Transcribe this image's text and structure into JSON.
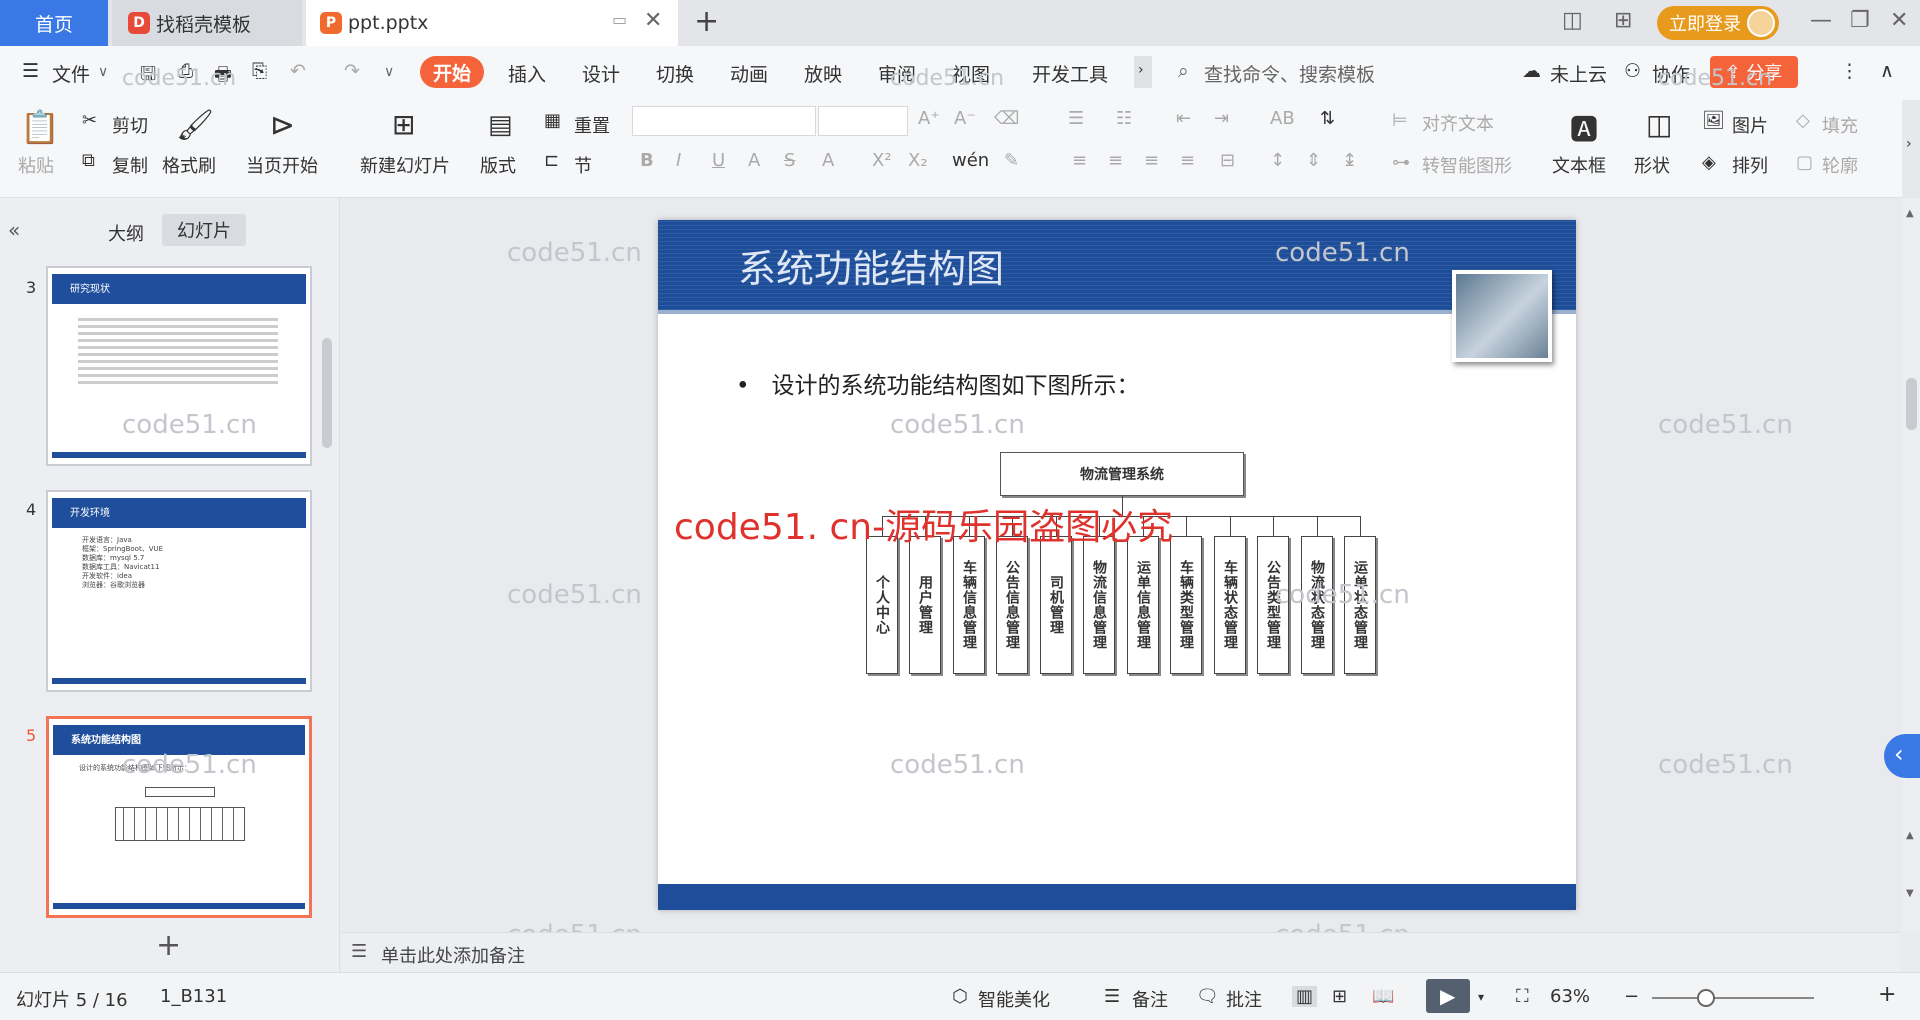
{
  "tabs": {
    "home": "首页",
    "template": "找稻壳模板",
    "doc": "ppt.pptx"
  },
  "header": {
    "login": "立即登录"
  },
  "menu": {
    "file": "文件",
    "items": [
      "开始",
      "插入",
      "设计",
      "切换",
      "动画",
      "放映",
      "审阅",
      "视图",
      "开发工具"
    ],
    "search": "查找命令、搜索模板",
    "cloud": "未上云",
    "collab": "协作",
    "share": "分享"
  },
  "ribbon": {
    "paste": "粘贴",
    "cut": "剪切",
    "copy": "复制",
    "format_painter": "格式刷",
    "start_current": "当页开始",
    "new_slide": "新建幻灯片",
    "layout": "版式",
    "section": "节",
    "reset": "重置",
    "align_text": "对齐文本",
    "smart_art": "转智能图形",
    "text_box": "文本框",
    "shape": "形状",
    "picture": "图片",
    "arrange": "排列",
    "fill": "填充",
    "outline": "轮廓"
  },
  "panel": {
    "outline_tab": "大纲",
    "slides_tab": "幻灯片"
  },
  "thumbs": [
    {
      "num": "3",
      "title": "研究现状"
    },
    {
      "num": "4",
      "title": "开发环境",
      "items": [
        "开发语言：Java",
        "框架：SpringBoot、VUE",
        "数据库：mysql 5.7",
        "数据库工具：Navicat11",
        "开发软件：idea",
        "浏览器：谷歌浏览器"
      ]
    },
    {
      "num": "5",
      "title": "系统功能结构图",
      "bullet": "设计的系统功能结构图如下图所示："
    }
  ],
  "slide": {
    "title": "系统功能结构图",
    "bullet": "设计的系统功能结构图如下图所示：",
    "root": "物流管理系统",
    "nodes": [
      "个人中心",
      "用户管理",
      "车辆信息管理",
      "公告信息管理",
      "司机管理",
      "物流信息管理",
      "运单信息管理",
      "车辆类型管理",
      "车辆状态管理",
      "公告类型管理",
      "物流状态管理",
      "运单状态管理"
    ]
  },
  "watermark": "code51.cn",
  "red_watermark": "code51. cn-源码乐园盗图必究",
  "notes": "单击此处添加备注",
  "status": {
    "slide_info": "幻灯片 5 / 16",
    "theme": "1_B131",
    "beautify": "智能美化",
    "notes": "备注",
    "comments": "批注",
    "zoom": "63%"
  }
}
